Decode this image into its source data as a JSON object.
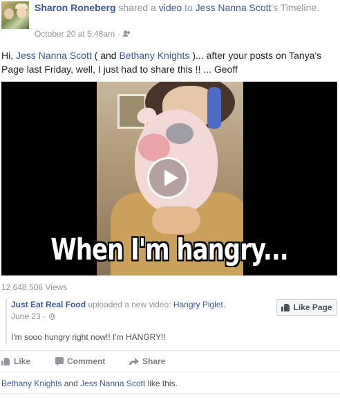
{
  "header": {
    "author": "Sharon Roneberg",
    "action_text": "shared a",
    "object_link": "video",
    "to_text": "to",
    "target": "Jess Nanna Scott",
    "target_suffix": "'s Timeline.",
    "timestamp": "October 20 at 5:48am",
    "separator": "·",
    "audience_icon": "friends-icon"
  },
  "message": {
    "greeting": "Hi,",
    "mention1": "Jess Nanna Scott",
    "between": "( and",
    "mention2": "Bethany Knights",
    "rest": ")... after your posts on Tanya's Page last Friday, well, I just had to share this !! ... Geoff"
  },
  "video": {
    "caption": "When I'm hangry...",
    "play_icon": "play-icon"
  },
  "views": "12,648,506 Views",
  "attachment": {
    "page_name": "Just Eat Real Food",
    "uploaded_text": "uploaded a new video:",
    "video_title": "Hangry Piglet.",
    "date": "June 23",
    "separator": "·",
    "audience_icon": "globe-icon",
    "description": "I'm sooo hungry right now!! I'm HANGRY!!",
    "like_page_label": "Like Page"
  },
  "actions": {
    "like": "Like",
    "comment": "Comment",
    "share": "Share"
  },
  "likes": {
    "person1": "Bethany Knights",
    "and": "and",
    "person2": "Jess Nanna Scott",
    "suffix": "like this."
  },
  "colors": {
    "link": "#3b5998",
    "muted": "#90949c"
  }
}
